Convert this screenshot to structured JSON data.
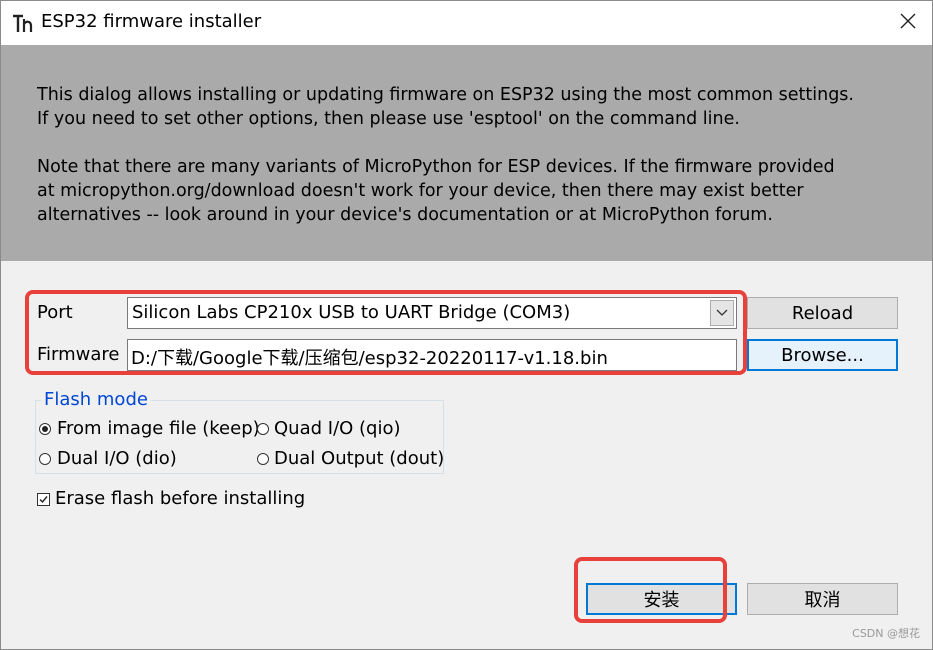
{
  "window": {
    "title": "ESP32 firmware installer",
    "close_glyph": "✕"
  },
  "info": {
    "line1": "This dialog allows installing or updating firmware on ESP32 using the most common settings.",
    "line2": "If you need to set other options, then please use 'esptool' on the command line.",
    "line3": "Note that there are many variants of MicroPython for ESP devices. If the firmware provided",
    "line4": "at micropython.org/download doesn't work for your device, then there may exist better",
    "line5": "alternatives -- look around in your device's documentation or at MicroPython forum."
  },
  "port": {
    "label": "Port",
    "value": "Silicon Labs CP210x USB to UART Bridge (COM3)",
    "reload_label": "Reload"
  },
  "firmware": {
    "label": "Firmware",
    "value": "D:/下载/Google下载/压缩包/esp32-20220117-v1.18.bin",
    "browse_label": "Browse..."
  },
  "flash_mode": {
    "title": "Flash mode",
    "options": [
      {
        "label": "From image file (keep)",
        "checked": true
      },
      {
        "label": "Quad I/O (qio)",
        "checked": false
      },
      {
        "label": "Dual I/O (dio)",
        "checked": false
      },
      {
        "label": "Dual Output (dout)",
        "checked": false
      }
    ]
  },
  "erase": {
    "label": "Erase flash before installing",
    "checked": true
  },
  "actions": {
    "install_label": "安装",
    "cancel_label": "取消"
  },
  "watermark": "CSDN @想花",
  "colors": {
    "highlight": "#e8413c",
    "group_title": "#0046d5",
    "focus": "#0078d7"
  }
}
